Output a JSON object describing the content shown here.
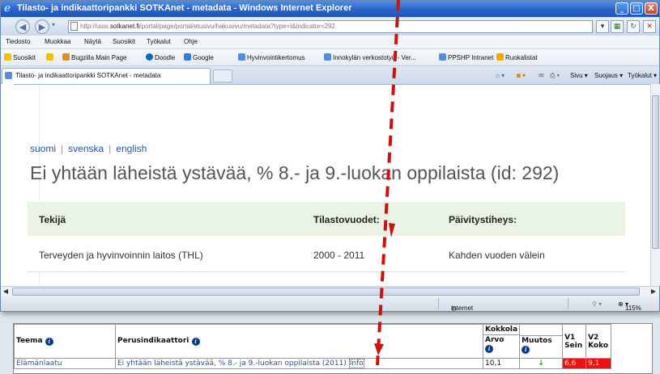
{
  "window": {
    "title": "Tilasto- ja indikaattoripankki SOTKAnet - metadata - Windows Internet Explorer",
    "min_label": "_",
    "max_label": "□",
    "close_label": "X"
  },
  "address": {
    "url_prefix": "http://uusi.",
    "url_domain": "sotkanet.fi",
    "url_rest": "/portal/page/portal/etusivu/hakusivu/metadata?type=I&indicator=292"
  },
  "menu": [
    "Tiedosto",
    "Muokkaa",
    "Näytä",
    "Suosikit",
    "Työkalut",
    "Ohje"
  ],
  "favorites": {
    "label": "Suosikit",
    "items": [
      "Bugzilla Main Page",
      "Doodle",
      "Google",
      "Hyvinvointikertomus",
      "Innokylän verkostotyö - Ver...",
      "PPSHP Intranet",
      "Ruokalistat"
    ]
  },
  "tab": {
    "label": "Tilasto- ja indikaattoripankki SOTKAnet - metadata"
  },
  "command_bar": [
    "Sivu ▾",
    "Suojaus ▾",
    "Työkalut ▾"
  ],
  "page": {
    "languages": [
      "suomi",
      "svenska",
      "english"
    ],
    "title": "Ei yhtään läheistä ystävää, % 8.- ja 9.-luokan oppilaista (id: 292)",
    "meta_headers": [
      "Tekijä",
      "Tilastovuodet:",
      "Päivitystiheys:"
    ],
    "meta_values": [
      "Terveyden ja hyvinvoinnin laitos (THL)",
      "2000 - 2011",
      "Kahden vuoden välein"
    ]
  },
  "status": {
    "zone": "Internet",
    "zoom": "115%"
  },
  "table": {
    "headers": {
      "teema": "Teema",
      "perus": "Perusindikaattori",
      "kokkola": "Kokkola",
      "arvo": "Arvo",
      "muutos": "Muutos",
      "v1": "V1",
      "v1b": "Sein",
      "v2": "V2",
      "v2b": "Koko"
    },
    "row": {
      "teema": "Elämänlaatu",
      "indicator": "Ei yhtään läheistä ystävää, % 8.- ja 9.-luokan oppilaista (2011)",
      "info": "Info",
      "arvo": "10,1",
      "v1": "6,6",
      "v2": "9,1"
    }
  },
  "colors": {
    "accent_red": "#dd1111",
    "header_green": "#e9f4e5",
    "link": "#3a7fc1"
  }
}
